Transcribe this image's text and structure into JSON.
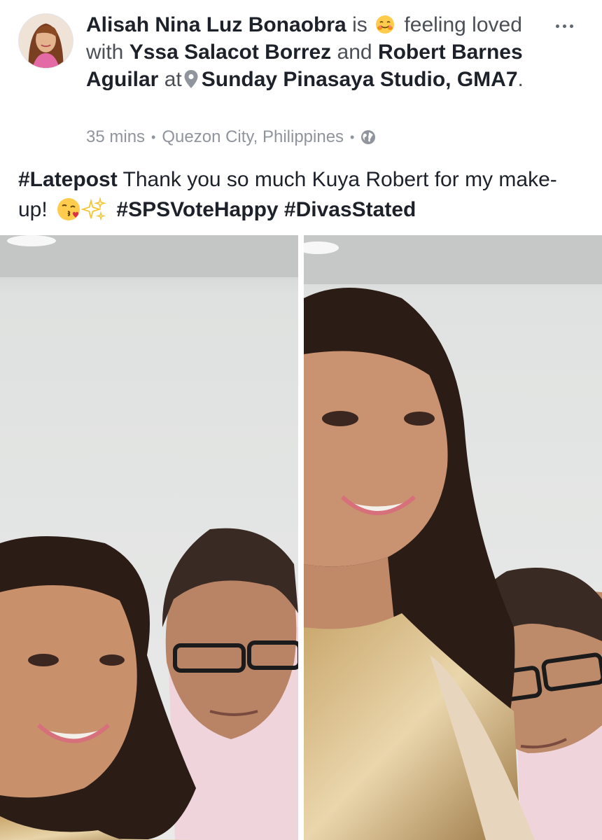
{
  "post": {
    "author": "Alisah Nina Luz Bonaobra",
    "is_text": "is",
    "feeling_text": "feeling",
    "feeling_state": "loved with",
    "tagged_1": "Yssa Salacot Borrez",
    "and_text": "and",
    "tagged_2": "Robert Barnes Aguilar",
    "at_text": "at",
    "location": "Sunday Pinasaya Studio, GMA7",
    "period": ".",
    "time": "35 mins",
    "place": "Quezon City, Philippines",
    "separator": "•",
    "privacy_icon": "globe-icon",
    "more_icon": "more-horizontal-icon",
    "feeling_emoji_icon": "smiling-hugging-face-icon",
    "location_icon": "map-pin-icon"
  },
  "caption": {
    "hashtag_latepost": "#Latepost",
    "text": " Thank you so much Kuya Robert for my make-up! ",
    "emoji_1": "kissing-face-icon",
    "emoji_2": "sparkles-icon",
    "hashtag_vote": "#SPSVoteHappy",
    "hashtag_divas": "#DivasStated"
  },
  "photos": [
    {
      "name": "selfie-photo-1"
    },
    {
      "name": "selfie-photo-2"
    }
  ],
  "colors": {
    "text_primary": "#1d2129",
    "text_secondary": "#4b4f56",
    "meta_gray": "#90949c",
    "icon_gray": "#616770"
  }
}
